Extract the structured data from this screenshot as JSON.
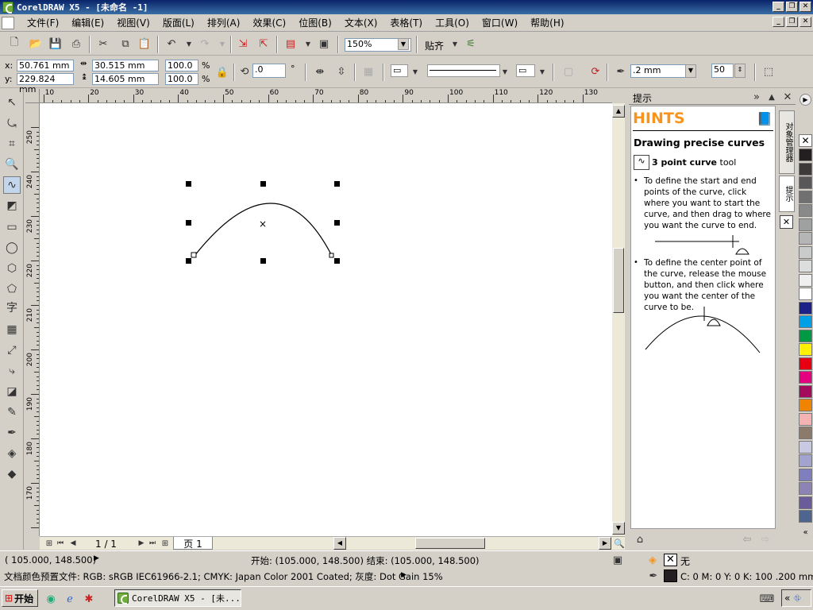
{
  "window": {
    "title": "CorelDRAW X5 - [未命名 -1]"
  },
  "menu": [
    "文件(F)",
    "编辑(E)",
    "视图(V)",
    "版面(L)",
    "排列(A)",
    "效果(C)",
    "位图(B)",
    "文本(X)",
    "表格(T)",
    "工具(O)",
    "窗口(W)",
    "帮助(H)"
  ],
  "toolbar": {
    "zoom": "150%",
    "snap_label": "贴齐"
  },
  "props": {
    "x_label": "x:",
    "x": "50.761 mm",
    "y_label": "y:",
    "y": "229.824 mm",
    "width": "30.515 mm",
    "height": "14.605 mm",
    "scale_w": "100.0",
    "scale_h": "100.0",
    "pct": "%",
    "angle": ".0",
    "deg": "°",
    "outline_width": ".2 mm",
    "nodes": "50"
  },
  "ruler": {
    "h": [
      "10",
      "20",
      "30",
      "40",
      "50",
      "60",
      "70",
      "80",
      "90",
      "100",
      "110",
      "120",
      "130"
    ],
    "v": [
      "250",
      "240",
      "230",
      "220",
      "210",
      "200",
      "190",
      "180",
      "170"
    ]
  },
  "pager": {
    "count": "1 / 1",
    "page_tab": "页 1"
  },
  "docker": {
    "title": "提示",
    "hints_title": "HINTS",
    "heading": "Drawing precise curves",
    "tool_name": "3 point curve",
    "tool_suffix": "tool",
    "bullet1": "To define the start and end points of the curve, click where you want to start the curve, and then drag to where you want the curve to end.",
    "bullet2": "To define the center point of the curve, release the mouse button, and then click where you want the center of the curve to be.",
    "tab1": "对象管理器",
    "tab2": "提示"
  },
  "palette_colors": [
    "#231f20",
    "#3e3a39",
    "#595757",
    "#717071",
    "#898989",
    "#9fa0a0",
    "#b5b5b6",
    "#c9caca",
    "#dcdddd",
    "#efefef",
    "#ffffff",
    "#1d2088",
    "#00a0e9",
    "#009944",
    "#fff100",
    "#e60012",
    "#e4007f",
    "#a40b5d",
    "#f08300",
    "#f5b2b2",
    "#8c7b6b",
    "#c9c9e3",
    "#a3a3cf",
    "#7f7fbf",
    "#8d84b5",
    "#6a5b9a",
    "#4e6590"
  ],
  "status": {
    "coords": "( 105.000, 148.500)",
    "start_end": "开始: (105.000, 148.500)  结束: (105.000, 148.500)",
    "fill_none": "无",
    "color_profile": "文档颜色预置文件: RGB: sRGB IEC61966-2.1; CMYK: Japan Color 2001 Coated; 灰度: Dot Gain 15%",
    "outline_info": "C: 0 M: 0 Y: 0 K: 100  .200 mm"
  },
  "taskbar": {
    "start": "开始",
    "task": "CorelDRAW X5 - [未..."
  }
}
